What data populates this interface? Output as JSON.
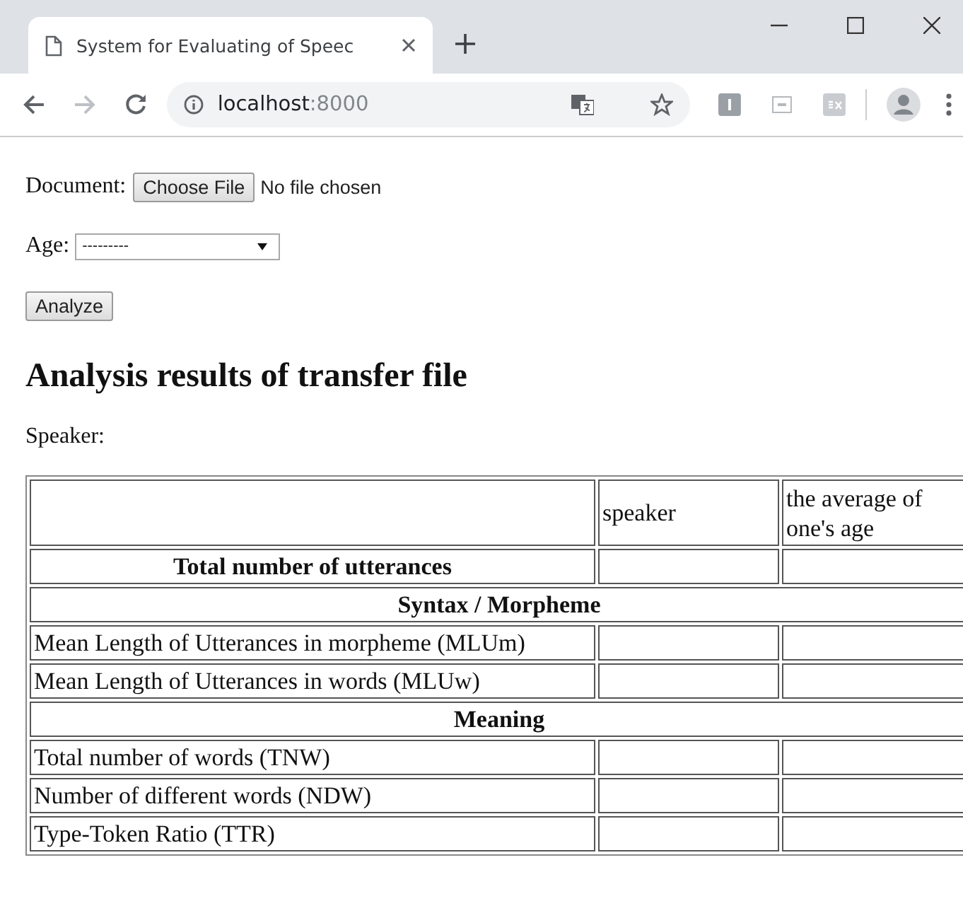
{
  "browser": {
    "tab": {
      "title": "System for Evaluating of Speec",
      "selected": true
    },
    "address": {
      "host": "localhost",
      "port": ":8000"
    }
  },
  "form": {
    "document_label": "Document:",
    "file_button": "Choose File",
    "file_status": "No file chosen",
    "age_label": "Age:",
    "age_select": {
      "value": "---------"
    },
    "analyze_button": "Analyze"
  },
  "heading": "Analysis results of transfer file",
  "speaker_label": "Speaker:",
  "table": {
    "columns": [
      "speaker",
      "the average of one's age"
    ],
    "rows": [
      {
        "kind": "total",
        "label": "Total number of utterances"
      },
      {
        "kind": "section",
        "label": "Syntax / Morpheme"
      },
      {
        "kind": "metric",
        "label": "Mean Length of Utterances in morpheme (MLUm)"
      },
      {
        "kind": "metric",
        "label": "Mean Length of Utterances in words (MLUw)"
      },
      {
        "kind": "section",
        "label": "Meaning"
      },
      {
        "kind": "metric",
        "label": "Total number of words (TNW)"
      },
      {
        "kind": "metric",
        "label": "Number of different words (NDW)"
      },
      {
        "kind": "metric",
        "label": "Type-Token Ratio (TTR)"
      }
    ]
  }
}
